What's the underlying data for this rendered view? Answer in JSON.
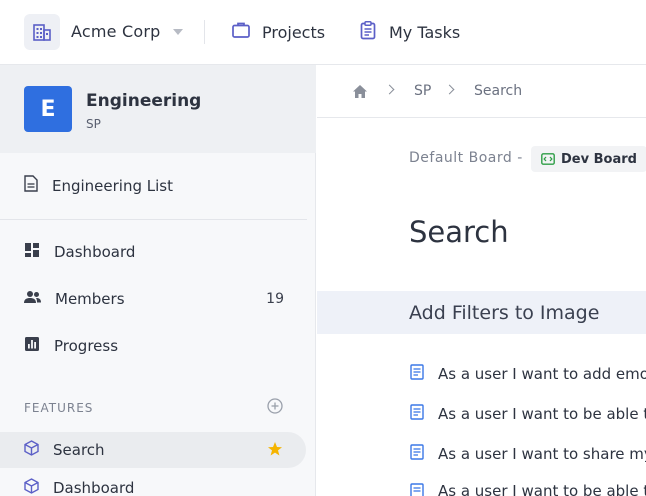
{
  "topbar": {
    "org_name": "Acme Corp",
    "nav": [
      {
        "label": "Projects",
        "icon": "briefcase-icon"
      },
      {
        "label": "My Tasks",
        "icon": "clipboard-icon"
      }
    ],
    "accent": "#5b5fc7"
  },
  "sidebar": {
    "project": {
      "avatar_letter": "E",
      "name": "Engineering",
      "key": "SP",
      "avatar_color": "#2f6fe0"
    },
    "list_item": "Engineering List",
    "items": [
      {
        "label": "Dashboard",
        "icon": "dashboard-icon"
      },
      {
        "label": "Members",
        "icon": "people-icon",
        "count": "19"
      },
      {
        "label": "Progress",
        "icon": "bar-chart-icon"
      }
    ],
    "features_label": "FEATURES",
    "features": [
      {
        "label": "Search",
        "icon": "cube-icon",
        "starred": true
      },
      {
        "label": "Dashboard",
        "icon": "cube-icon"
      }
    ]
  },
  "breadcrumb": {
    "home_icon": "home-icon",
    "items": [
      "SP",
      "Search"
    ]
  },
  "main": {
    "board_prefix": "Default Board -",
    "board_chip": "Dev Board",
    "title": "Search",
    "group_title": "Add Filters to Image",
    "stories": [
      "As a user I want to add emoji",
      "As a user I want to be able to",
      "As a user I want to share my",
      "As a user I want to be able to"
    ]
  }
}
